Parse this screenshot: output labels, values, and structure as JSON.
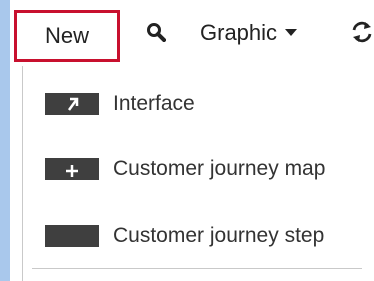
{
  "toolbar": {
    "new_label": "New",
    "graphic_label": "Graphic",
    "icons": {
      "search": "search-icon",
      "dropdown": "chevron-down-icon",
      "refresh": "refresh-icon"
    }
  },
  "menu": {
    "items": [
      {
        "label": "Interface",
        "icon": "interface-icon"
      },
      {
        "label": "Customer journey map",
        "icon": "plus-icon"
      },
      {
        "label": "Customer journey step",
        "icon": "journey-step-icon"
      }
    ]
  },
  "colors": {
    "accent_border": "#c8102e",
    "icon_tile": "#3f3f3f",
    "background": "#a9c8ec"
  }
}
